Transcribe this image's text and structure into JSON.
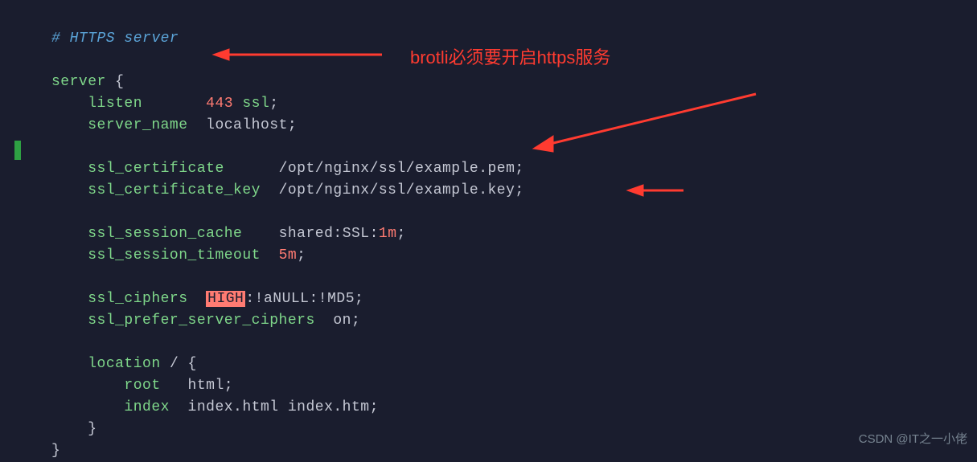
{
  "code": {
    "comment": "# HTTPS server",
    "server_kw": "server",
    "brace_open": " {",
    "listen_kw": "listen",
    "listen_val_num": "443",
    "listen_val_ssl": " ssl",
    "semi": ";",
    "server_name_kw": "server_name",
    "server_name_val": "localhost",
    "ssl_cert_kw": "ssl_certificate",
    "ssl_cert_val": "/opt/nginx/ssl/example.pem",
    "ssl_cert_key_kw": "ssl_certificate_key",
    "ssl_cert_key_val": "/opt/nginx/ssl/example.key",
    "ssl_sess_cache_kw": "ssl_session_cache",
    "ssl_sess_cache_val": "shared:SSL:",
    "ssl_sess_cache_num": "1m",
    "ssl_sess_timeout_kw": "ssl_session_timeout",
    "ssl_sess_timeout_val": "5m",
    "ssl_ciphers_kw": "ssl_ciphers",
    "ssl_ciphers_high": "HIGH",
    "ssl_ciphers_rest": ":!aNULL:!MD5",
    "ssl_prefer_kw": "ssl_prefer_server_ciphers",
    "ssl_prefer_val": "on",
    "location_kw": "location",
    "location_path": " / {",
    "root_kw": "root",
    "root_val": "html",
    "index_kw": "index",
    "index_val": "index.html index.htm",
    "brace_close": "}"
  },
  "annotation": {
    "text": "brotli必须要开启https服务"
  },
  "watermark": "CSDN @IT之一小佬"
}
